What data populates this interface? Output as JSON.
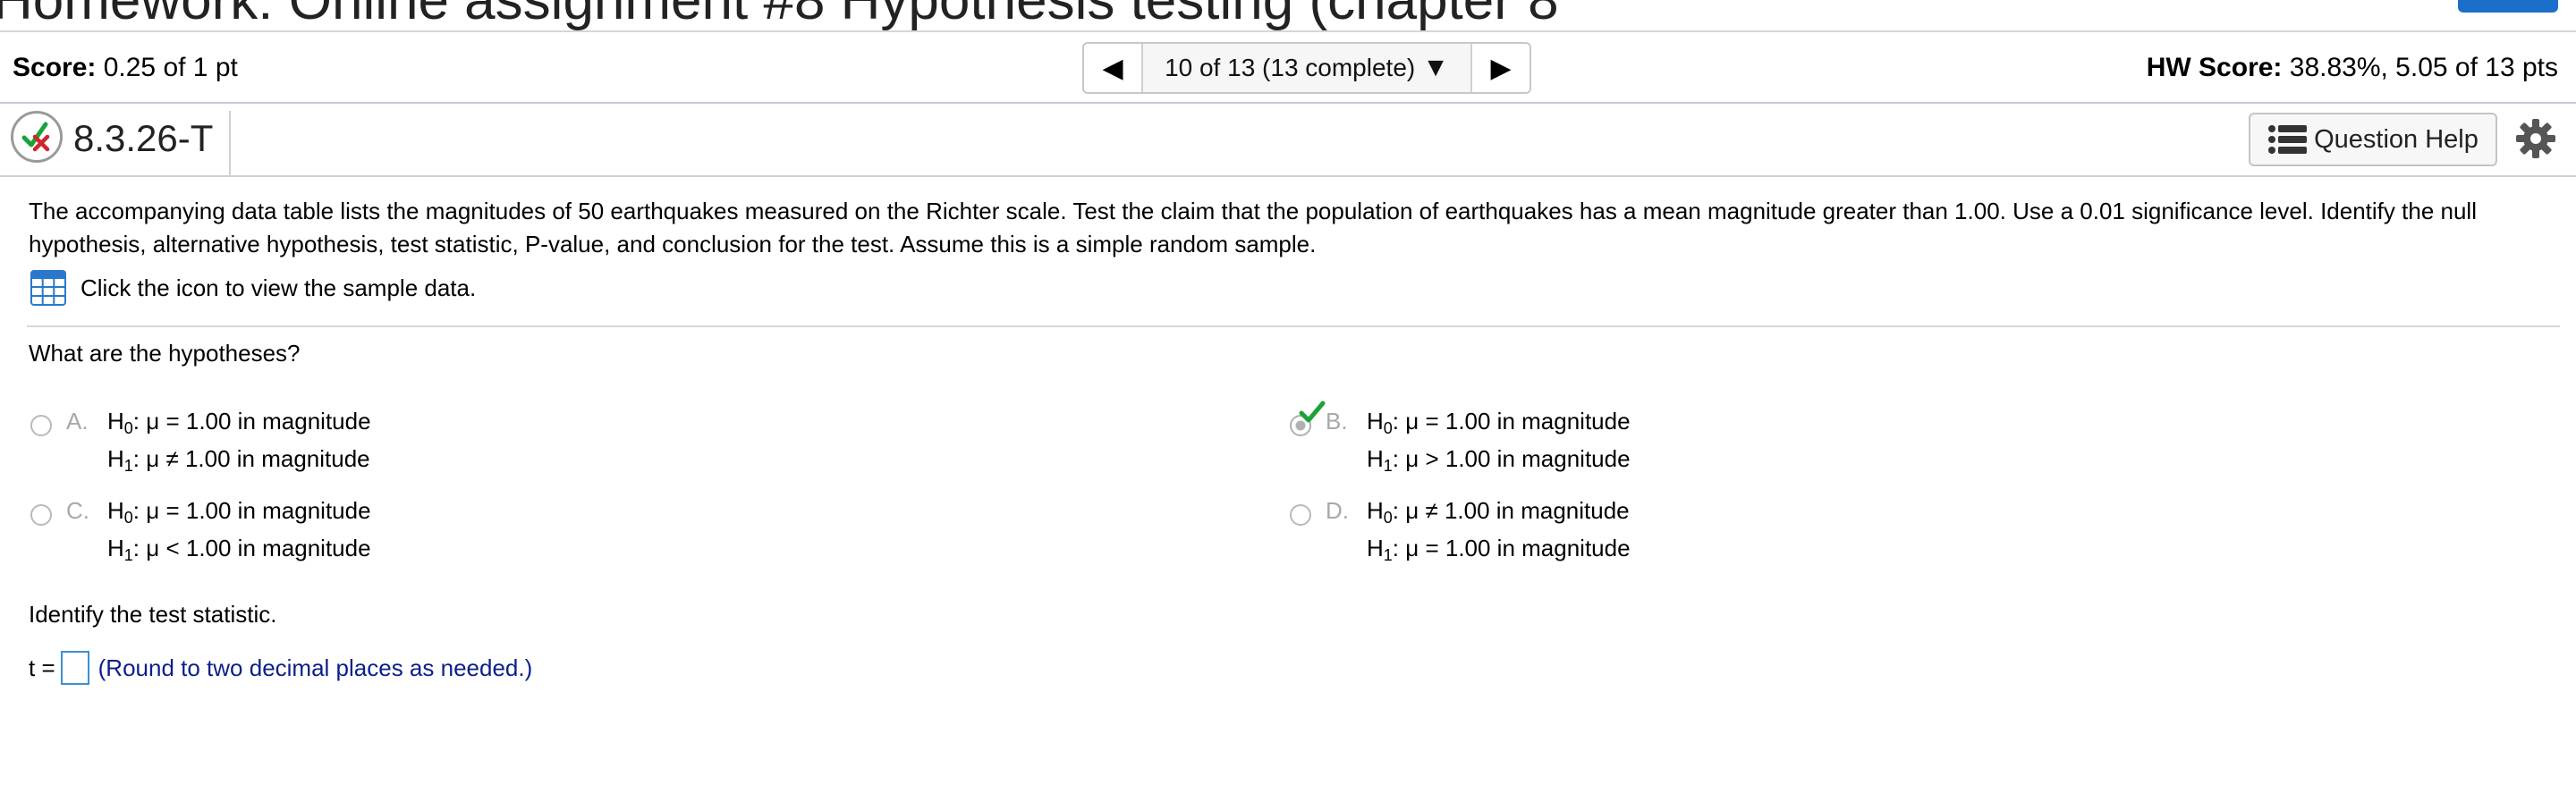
{
  "header": {
    "title": "Homework: Online assignment #8 Hypothesis testing (chapter 8"
  },
  "score_bar": {
    "score_label": "Score:",
    "score_value": "0.25 of 1 pt",
    "pager_prev": "◀",
    "pager_label": "10 of 13 (13 complete)",
    "pager_caret": "▼",
    "pager_next": "▶",
    "hw_score_label": "HW Score:",
    "hw_score_value": "38.83%, 5.05 of 13 pts"
  },
  "question_header": {
    "id": "8.3.26-T",
    "help_label": "Question Help",
    "status_icon": "partial-credit-icon",
    "settings_icon": "gear-icon",
    "help_icon": "list-icon"
  },
  "body": {
    "prompt": "The accompanying data table lists the magnitudes of 50 earthquakes measured on the Richter scale. Test the claim that the population of earthquakes has a mean magnitude greater than 1.00. Use a 0.01 significance level. Identify the null hypothesis, alternative hypothesis, test statistic, P-value, and conclusion for the test. Assume this is a simple random sample.",
    "data_link": "Click the icon to view the sample data.",
    "question": "What are the hypotheses?",
    "options": [
      {
        "letter": "A.",
        "h0_prefix": "H",
        "h0_sub": "0",
        "h0_rest": ": μ = 1.00 in magnitude",
        "h1_prefix": "H",
        "h1_sub": "1",
        "h1_rest": ": μ ≠ 1.00 in magnitude",
        "selected": false
      },
      {
        "letter": "B.",
        "h0_prefix": "H",
        "h0_sub": "0",
        "h0_rest": ": μ = 1.00 in magnitude",
        "h1_prefix": "H",
        "h1_sub": "1",
        "h1_rest": ": μ > 1.00 in magnitude",
        "selected": true
      },
      {
        "letter": "C.",
        "h0_prefix": "H",
        "h0_sub": "0",
        "h0_rest": ": μ = 1.00 in magnitude",
        "h1_prefix": "H",
        "h1_sub": "1",
        "h1_rest": ": μ < 1.00 in magnitude",
        "selected": false
      },
      {
        "letter": "D.",
        "h0_prefix": "H",
        "h0_sub": "0",
        "h0_rest": ": μ ≠ 1.00 in magnitude",
        "h1_prefix": "H",
        "h1_sub": "1",
        "h1_rest": ": μ = 1.00 in magnitude",
        "selected": false
      }
    ],
    "identify": "Identify the test statistic.",
    "t_label": "t =",
    "t_value": "",
    "t_hint": "(Round to two decimal places as needed.)"
  },
  "colors": {
    "accent": "#1b6fc8",
    "correct": "#1aa33a",
    "incorrect": "#d0262d",
    "hint": "#0b1f8a"
  }
}
